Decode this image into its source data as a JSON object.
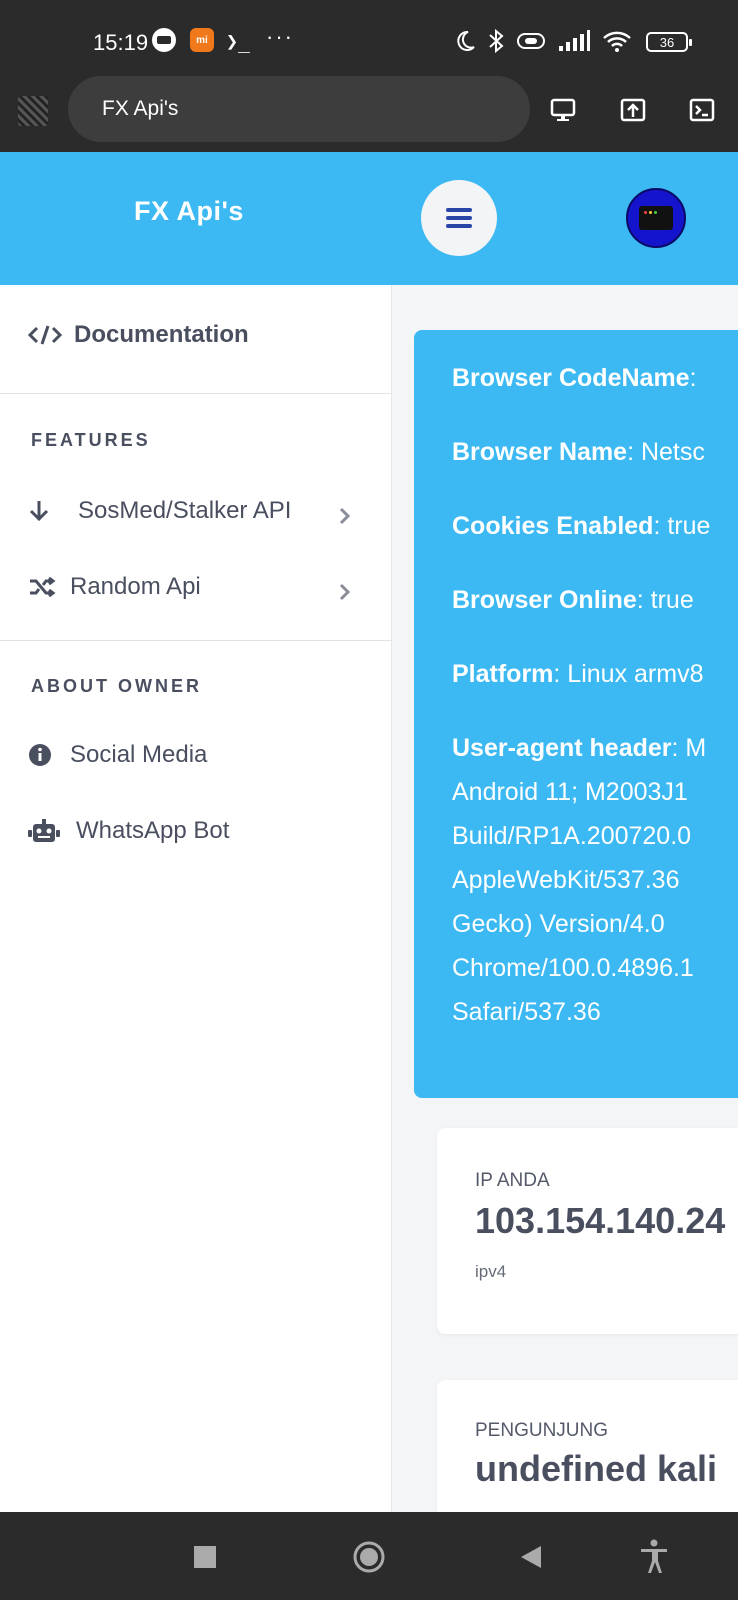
{
  "status_bar": {
    "time": "15:19",
    "app_icon_label": "mi",
    "terminal_glyph": "❯_",
    "overflow": "···",
    "battery": "36"
  },
  "browser": {
    "url_title": "FX Api's"
  },
  "header": {
    "brand": "FX Api's"
  },
  "sidebar": {
    "documentation": "Documentation",
    "features_title": "FEATURES",
    "features": [
      {
        "label": "SosMed/Stalker API"
      },
      {
        "label": "Random Api"
      }
    ],
    "about_title": "ABOUT OWNER",
    "about": [
      {
        "label": "Social Media"
      },
      {
        "label": "WhatsApp Bot"
      }
    ]
  },
  "info": {
    "codename_key": "Browser CodeName",
    "codename_val": ":",
    "name_key": "Browser Name",
    "name_val": ": Netsc",
    "cookies_key": "Cookies Enabled",
    "cookies_val": ": true",
    "online_key": "Browser Online",
    "online_val": ": true",
    "platform_key": "Platform",
    "platform_val": ": Linux armv8",
    "ua_key": "User-agent header",
    "ua_val": ": M",
    "ua_lines": [
      "Android 11; M2003J1",
      "Build/RP1A.200720.0",
      "AppleWebKit/537.36",
      "Gecko) Version/4.0",
      "Chrome/100.0.4896.1",
      "Safari/537.36"
    ]
  },
  "ip_card": {
    "label": "IP ANDA",
    "value": "103.154.140.24",
    "sub": "ipv4"
  },
  "visitor_card": {
    "label": "PENGUNJUNG",
    "value": "undefined kali"
  }
}
